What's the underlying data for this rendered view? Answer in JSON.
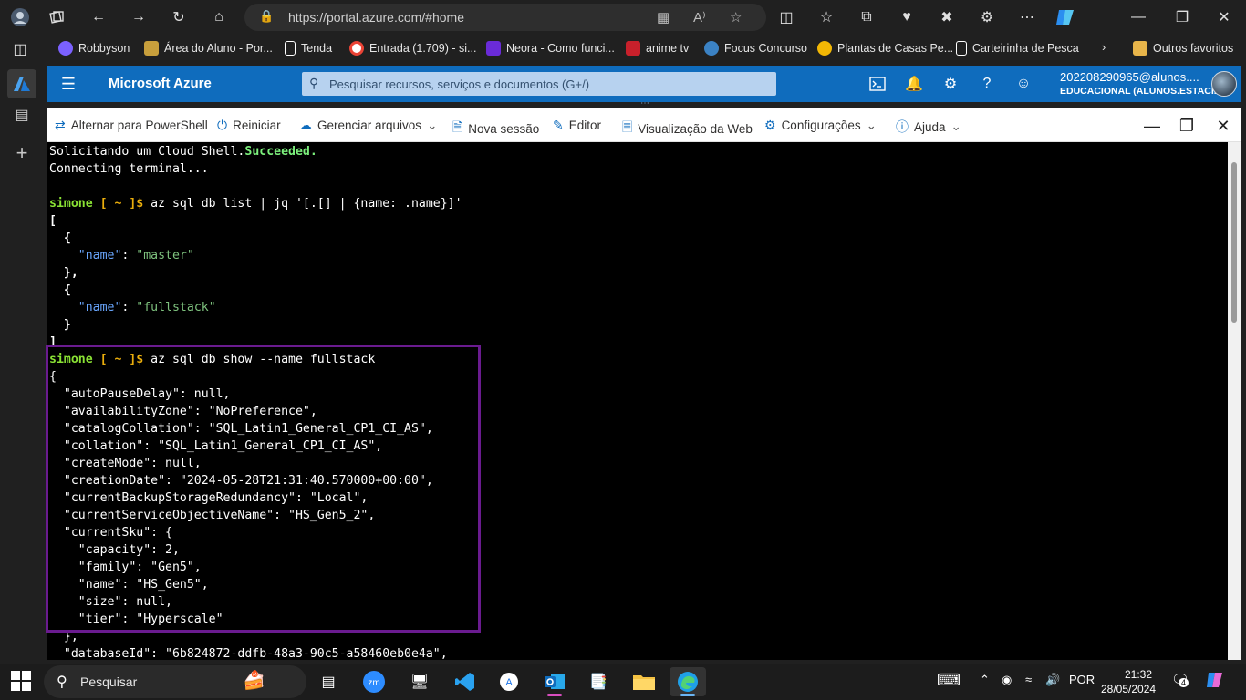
{
  "browser": {
    "url": "https://portal.azure.com/#home",
    "bookmarks": [
      {
        "label": "Robbyson",
        "color": "#7b61ff"
      },
      {
        "label": "Área do Aluno - Por...",
        "color": "#c89f3c"
      },
      {
        "label": "Tenda",
        "color": "#ffffff"
      },
      {
        "label": "Entrada (1.709) - si...",
        "color": "#ea4335"
      },
      {
        "label": "Neora - Como funci...",
        "color": "#6a2bd8"
      },
      {
        "label": "anime tv",
        "color": "#c8202b"
      },
      {
        "label": "Focus Concurso",
        "color": "#3b82c4"
      },
      {
        "label": "Plantas de Casas Pe...",
        "color": "#f2b705"
      },
      {
        "label": "Carteirinha de Pesca",
        "color": "#ffffff"
      }
    ],
    "other_favorites": "Outros favoritos"
  },
  "azure": {
    "title": "Microsoft Azure",
    "search_placeholder": "Pesquisar recursos, serviços e documentos (G+/)",
    "user_name": "202208290965@alunos....",
    "user_tenant": "EDUCACIONAL (ALUNOS.ESTACI..."
  },
  "cloudshell": {
    "toolbar": {
      "powershell": "Alternar para PowerShell",
      "restart": "Reiniciar",
      "manage_files": "Gerenciar arquivos",
      "new_session": "Nova sessão",
      "editor": "Editor",
      "web_preview": "Visualização da Web",
      "settings": "Configurações",
      "help": "Ajuda"
    },
    "terminal": {
      "l1_a": "Solicitando um Cloud Shell.",
      "l1_b": "Succeeded.",
      "l2": "Connecting terminal...",
      "prompt_user": "simone",
      "prompt_path": " [ ~ ]$",
      "cmd1": " az sql db list | jq '[.[] | {name: .name}]'",
      "open_bracket": "[",
      "open_brace": "  {",
      "name_key": "\"name\"",
      "name_val_1": "\"master\"",
      "close_brace_comma": "  },",
      "name_val_2": "\"fullstack\"",
      "close_brace": "  }",
      "close_bracket": "]",
      "cmd2": " az sql db show --name fullstack",
      "show_open": "{",
      "show_lines": [
        "  \"autoPauseDelay\": null,",
        "  \"availabilityZone\": \"NoPreference\",",
        "  \"catalogCollation\": \"SQL_Latin1_General_CP1_CI_AS\",",
        "  \"collation\": \"SQL_Latin1_General_CP1_CI_AS\",",
        "  \"createMode\": null,",
        "  \"creationDate\": \"2024-05-28T21:31:40.570000+00:00\",",
        "  \"currentBackupStorageRedundancy\": \"Local\",",
        "  \"currentServiceObjectiveName\": \"HS_Gen5_2\",",
        "  \"currentSku\": {",
        "    \"capacity\": 2,",
        "    \"family\": \"Gen5\",",
        "    \"name\": \"HS_Gen5\",",
        "    \"size\": null,",
        "    \"tier\": \"Hyperscale\"",
        "  },",
        "  \"databaseId\": \"6b824872-ddfb-48a3-90c5-a58460eb0e4a\","
      ]
    }
  },
  "taskbar": {
    "search": "Pesquisar",
    "language": "POR",
    "time": "21:32",
    "date": "28/05/2024",
    "notifications": "4"
  }
}
